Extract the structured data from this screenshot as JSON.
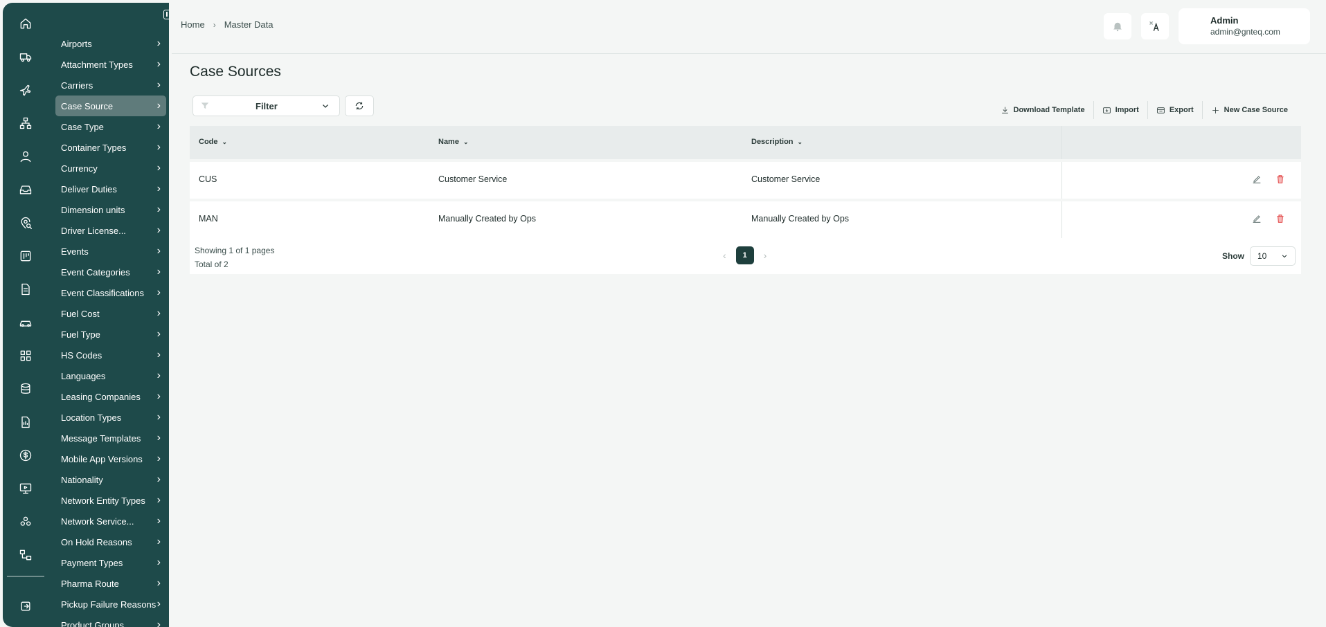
{
  "breadcrumb": {
    "home": "Home",
    "current": "Master Data"
  },
  "user": {
    "name": "Admin",
    "email": "admin@gnteq.com"
  },
  "page": {
    "title": "Case Sources"
  },
  "filter": {
    "label": "Filter"
  },
  "actions": {
    "download": "Download Template",
    "import": "Import",
    "export": "Export",
    "new": "New Case Source"
  },
  "table": {
    "headers": {
      "code": "Code",
      "name": "Name",
      "description": "Description"
    },
    "rows": [
      {
        "code": "CUS",
        "name": "Customer Service",
        "description": "Customer Service"
      },
      {
        "code": "MAN",
        "name": "Manually Created by Ops",
        "description": "Manually Created by Ops"
      }
    ]
  },
  "pagination": {
    "showing": "Showing 1 of 1 pages",
    "total": "Total of 2",
    "current_page": "1",
    "show_label": "Show",
    "page_size": "10"
  },
  "sidebar": {
    "items": [
      {
        "label": "Airports"
      },
      {
        "label": "Attachment Types"
      },
      {
        "label": "Carriers"
      },
      {
        "label": "Case Source"
      },
      {
        "label": "Case Type"
      },
      {
        "label": "Container Types"
      },
      {
        "label": "Currency"
      },
      {
        "label": "Deliver Duties"
      },
      {
        "label": "Dimension units"
      },
      {
        "label": "Driver License..."
      },
      {
        "label": "Events"
      },
      {
        "label": "Event Categories"
      },
      {
        "label": "Event Classifications"
      },
      {
        "label": "Fuel Cost"
      },
      {
        "label": "Fuel Type"
      },
      {
        "label": "HS Codes"
      },
      {
        "label": "Languages"
      },
      {
        "label": "Leasing Companies"
      },
      {
        "label": "Location Types"
      },
      {
        "label": "Message Templates"
      },
      {
        "label": "Mobile App Versions"
      },
      {
        "label": "Nationality"
      },
      {
        "label": "Network Entity Types"
      },
      {
        "label": "Network Service..."
      },
      {
        "label": "On Hold Reasons"
      },
      {
        "label": "Payment Types"
      },
      {
        "label": "Pharma Route"
      },
      {
        "label": "Pickup Failure Reasons"
      },
      {
        "label": "Product Groups"
      }
    ],
    "active_index": 3
  },
  "colors": {
    "sidebar_bg": "#1e4a4a",
    "active_item": "#5f7b7b",
    "delete_red": "#e03a3a"
  }
}
